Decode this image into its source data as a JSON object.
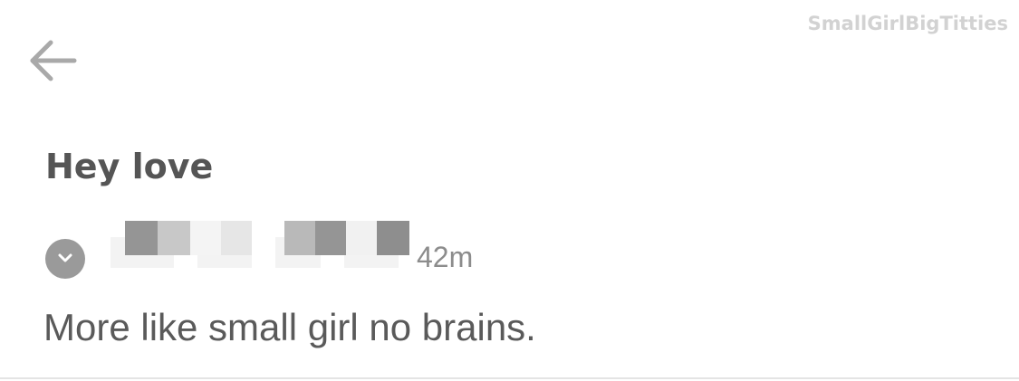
{
  "watermark": "SmallGirlBigTitties",
  "icons": {
    "back": "arrow-left-icon",
    "expand": "chevron-down-icon"
  },
  "comment": {
    "title": "Hey love",
    "timestamp": "42m",
    "body": "More like small girl no brains."
  },
  "colors": {
    "title": "#555555",
    "body": "#5a5a5a",
    "muted": "#8c8c8c",
    "watermark": "#d2d2d2",
    "expand_button_bg": "#9a9a9a"
  }
}
